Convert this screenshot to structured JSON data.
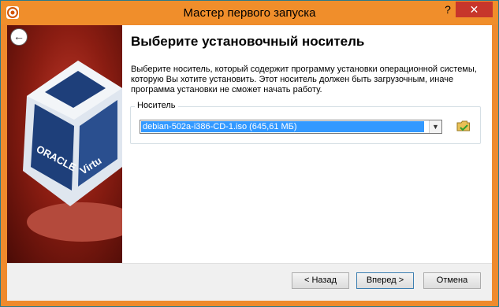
{
  "window": {
    "title": "Мастер первого запуска",
    "help_glyph": "?",
    "close_glyph": "✕"
  },
  "page": {
    "heading": "Выберите установочный носитель",
    "description": "Выберите носитель, который содержит программу установки операционной системы, которую Вы хотите установить. Этот носитель должен быть загрузочным, иначе программа установки не сможет начать работу.",
    "group_label": "Носитель",
    "media_selected": "debian-502a-i386-CD-1.iso (645,61 МБ)"
  },
  "buttons": {
    "back": "< Назад",
    "next": "Вперед >",
    "cancel": "Отмена"
  },
  "colors": {
    "titlebar": "#f08e2b",
    "close": "#c7362b",
    "selection": "#3399ff"
  }
}
